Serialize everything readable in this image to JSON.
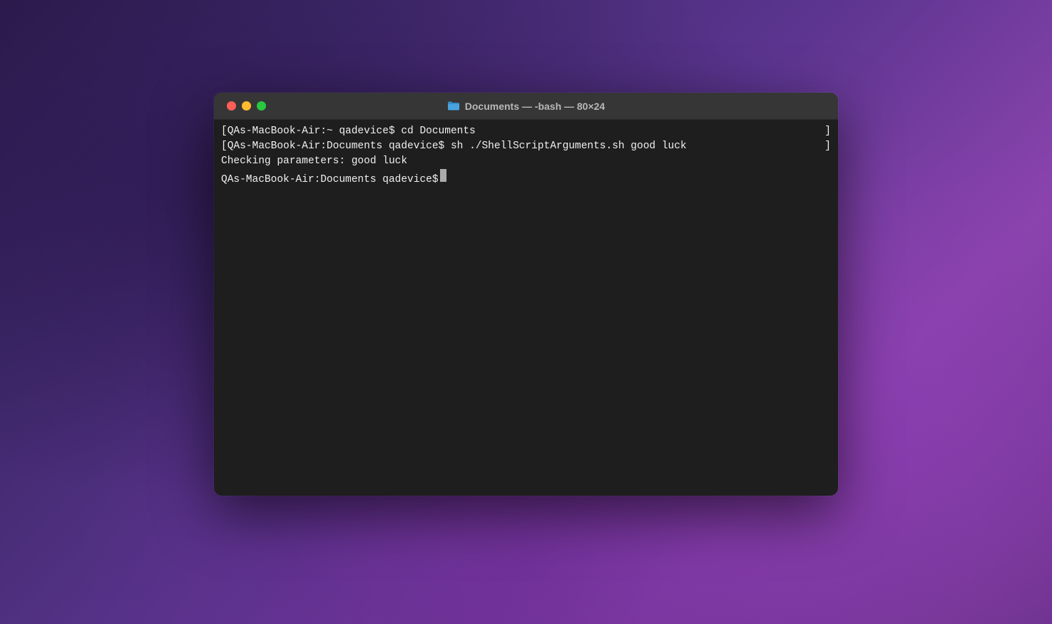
{
  "window": {
    "title": "Documents — -bash — 80×24",
    "folder_icon_color": "#4aa3df"
  },
  "traffic_lights": {
    "close": "#ff5f57",
    "minimize": "#febc2e",
    "maximize": "#28c840"
  },
  "terminal": {
    "lines": [
      {
        "bracketed": true,
        "prompt": "QAs-MacBook-Air:~ qadevice$ ",
        "command": "cd Documents"
      },
      {
        "bracketed": true,
        "prompt": "QAs-MacBook-Air:Documents qadevice$ ",
        "command": "sh ./ShellScriptArguments.sh good luck"
      },
      {
        "bracketed": false,
        "output": "Checking parameters: good luck"
      }
    ],
    "current_prompt": "QAs-MacBook-Air:Documents qadevice$ "
  }
}
